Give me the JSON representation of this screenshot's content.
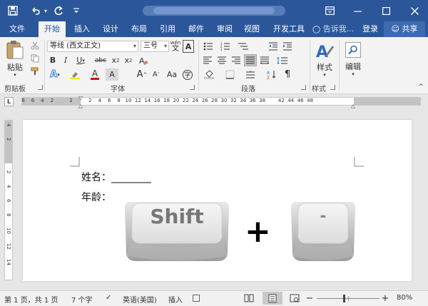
{
  "titlebar": {
    "icons": [
      "save-icon",
      "undo-icon",
      "redo-icon",
      "customize-icon",
      "ribbon-display-icon",
      "minimize-icon",
      "maximize-icon",
      "close-icon"
    ]
  },
  "tabs": [
    {
      "label": "文件"
    },
    {
      "label": "开始"
    },
    {
      "label": "插入"
    },
    {
      "label": "设计"
    },
    {
      "label": "布局"
    },
    {
      "label": "引用"
    },
    {
      "label": "邮件"
    },
    {
      "label": "审阅"
    },
    {
      "label": "视图"
    },
    {
      "label": "开发工具"
    }
  ],
  "tell_me": "告诉我...",
  "login": "登录",
  "share": "共享",
  "ribbon": {
    "paste_label": "粘贴",
    "font_name": "等线 (西文正文)",
    "font_size": "三号",
    "wen_glyph": "wén",
    "groups": {
      "clipboard": "剪贴板",
      "font": "字体",
      "paragraph": "段落",
      "styles": "样式"
    },
    "styles_label": "样式",
    "editing_label": "编辑"
  },
  "ruler": {
    "left_nums": [
      "8",
      "6",
      "4",
      "2",
      "",
      "2"
    ],
    "right_nums": [
      "2",
      "4",
      "6",
      "8",
      "10",
      "12",
      "14",
      "16",
      "18",
      "20",
      "22",
      "24",
      "26",
      "28",
      "30",
      "32",
      "34",
      "36",
      "38"
    ],
    "far_nums": [
      "42",
      "44",
      "46",
      "48"
    ]
  },
  "document": {
    "line1": "姓名：________",
    "line2": "年龄：",
    "key1": "Shift",
    "plus": "+",
    "key2": "-"
  },
  "status": {
    "page": "第 1 页，共 1 页",
    "words": "7 个字",
    "language": "英语(美国)",
    "mode": "插入",
    "zoom": "80%"
  }
}
